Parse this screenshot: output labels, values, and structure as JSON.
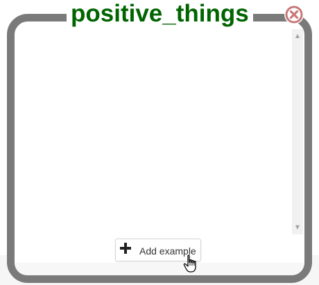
{
  "panel": {
    "title": "positive_things",
    "title_color": "#006400",
    "frame_color": "#7a7a7a"
  },
  "close_button": {
    "icon": "close-circle-icon",
    "color": "#c87878"
  },
  "scrollbar": {
    "up_arrow": "▲",
    "down_arrow": "▼"
  },
  "add_button": {
    "icon": "plus-icon",
    "label": "Add example"
  },
  "cursor": {
    "icon": "hand-pointer-cursor-icon"
  }
}
